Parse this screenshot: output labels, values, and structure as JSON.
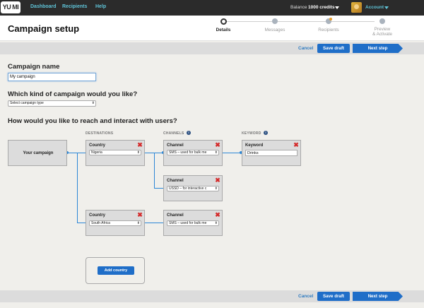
{
  "topbar": {
    "logo_text": "YU MI",
    "nav": [
      "Dashboard",
      "Recipients",
      "Help"
    ],
    "balance_label": "Balance",
    "balance_value": "1000 credits",
    "account_label": "Account"
  },
  "header": {
    "title": "Campaign setup",
    "steps": [
      {
        "label": "Details",
        "active": true
      },
      {
        "label": "Messages",
        "active": false
      },
      {
        "label": "Recipients",
        "active": false,
        "warning": true
      },
      {
        "label": "Preview\n& Activate",
        "active": false
      }
    ]
  },
  "actions": {
    "cancel": "Cancel",
    "save_draft": "Save draft",
    "next_step": "Next step"
  },
  "form": {
    "name_heading": "Campaign name",
    "name_value": "My campaign",
    "kind_heading": "Which kind of campaign would you like?",
    "kind_select": "Select campaign type",
    "reach_heading": "How would you like to reach and interact with users?"
  },
  "flow": {
    "col_destinations": "DESTINATIONS",
    "col_channels": "CHANNELS",
    "col_keyword": "KEYWORD",
    "campaign_node": "Your campaign",
    "country_title": "Country",
    "channel_title": "Channel",
    "keyword_title": "Keyword",
    "countries": [
      "Nigeria",
      "South Africa"
    ],
    "channels": [
      "SMS – used for bulk me",
      "USSD – for interactive c",
      "SMS – used for bulk me"
    ],
    "keyword_value": "Drinks",
    "add_country": "Add country"
  },
  "colors": {
    "accent": "#1f6ec8",
    "nav_link": "#5fc4d8",
    "delete": "#d42a2a",
    "connector": "#2c86d6"
  }
}
